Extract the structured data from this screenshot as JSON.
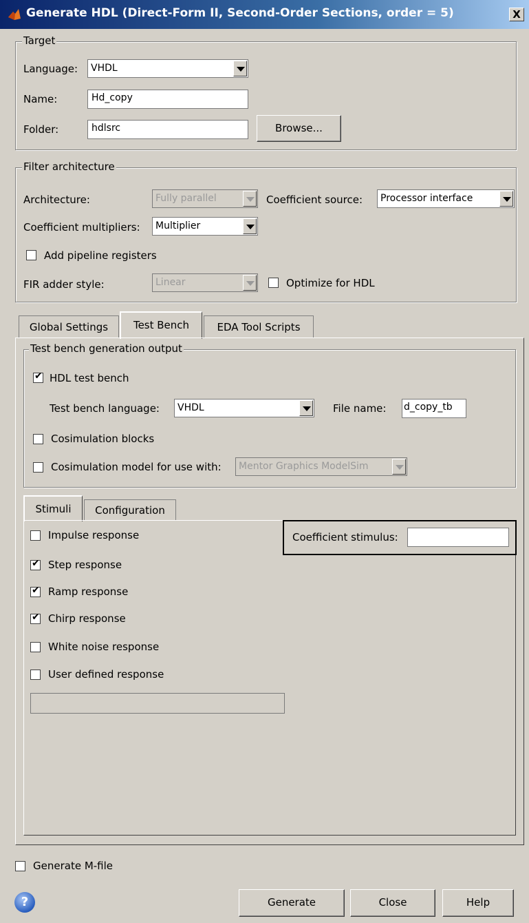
{
  "window": {
    "title": "Generate HDL (Direct-Form II, Second-Order Sections, order = 5)",
    "close_label": "X"
  },
  "target": {
    "legend": "Target",
    "language_label": "Language:",
    "language_value": "VHDL",
    "name_label": "Name:",
    "name_value": "Hd_copy",
    "folder_label": "Folder:",
    "folder_value": "hdlsrc",
    "browse_label": "Browse..."
  },
  "filter_arch": {
    "legend": "Filter architecture",
    "architecture_label": "Architecture:",
    "architecture_value": "Fully parallel",
    "coeff_source_label": "Coefficient source:",
    "coeff_source_value": "Processor interface",
    "coeff_mult_label": "Coefficient multipliers:",
    "coeff_mult_value": "Multiplier",
    "pipeline_label": "Add pipeline registers",
    "pipeline_checked": false,
    "fir_adder_label": "FIR adder style:",
    "fir_adder_value": "Linear",
    "optimize_label": "Optimize for HDL",
    "optimize_checked": false
  },
  "tabs": [
    {
      "label": "Global Settings",
      "active": false
    },
    {
      "label": "Test Bench",
      "active": true
    },
    {
      "label": "EDA Tool Scripts",
      "active": false
    }
  ],
  "test_bench": {
    "legend": "Test bench generation output",
    "hdl_tb_label": "HDL test bench",
    "hdl_tb_checked": true,
    "tb_language_label": "Test bench language:",
    "tb_language_value": "VHDL",
    "file_name_label": "File name:",
    "file_name_value": "d_copy_tb",
    "cosim_blocks_label": "Cosimulation blocks",
    "cosim_blocks_checked": false,
    "cosim_model_label": "Cosimulation model for use with:",
    "cosim_model_checked": false,
    "cosim_model_value": "Mentor Graphics ModelSim"
  },
  "subtabs": [
    {
      "label": "Stimuli",
      "active": true
    },
    {
      "label": "Configuration",
      "active": false
    }
  ],
  "stimuli": {
    "items": [
      {
        "label": "Impulse response",
        "checked": false
      },
      {
        "label": "Step response",
        "checked": true
      },
      {
        "label": "Ramp response",
        "checked": true
      },
      {
        "label": "Chirp response",
        "checked": true
      },
      {
        "label": "White noise response",
        "checked": false
      },
      {
        "label": "User defined response",
        "checked": false
      }
    ],
    "user_defined_value": "",
    "coeff_stimulus_label": "Coefficient stimulus:",
    "coeff_stimulus_value": ""
  },
  "footer": {
    "generate_mfile_label": "Generate M-file",
    "generate_mfile_checked": false,
    "help_icon_glyph": "?",
    "generate_label": "Generate",
    "close_label": "Close",
    "help_label": "Help"
  }
}
